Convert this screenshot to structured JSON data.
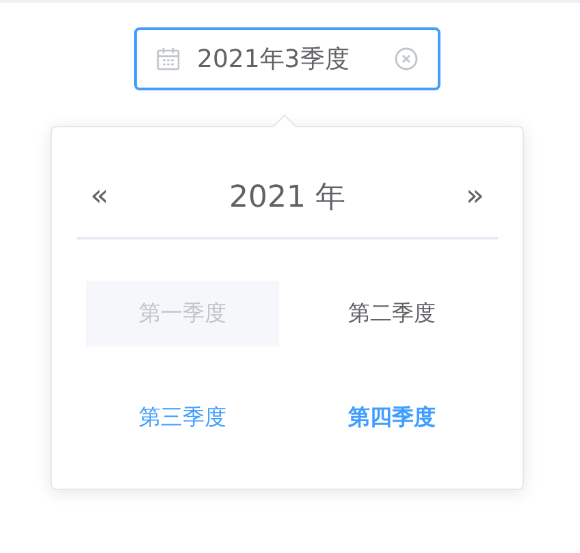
{
  "input": {
    "value": "2021年3季度"
  },
  "panel": {
    "prev": "«",
    "year": "2021 年",
    "next": "»"
  },
  "quarters": [
    {
      "label": "第一季度",
      "disabled": true,
      "selected": false,
      "current": false
    },
    {
      "label": "第二季度",
      "disabled": false,
      "selected": false,
      "current": false
    },
    {
      "label": "第三季度",
      "disabled": false,
      "selected": true,
      "current": false
    },
    {
      "label": "第四季度",
      "disabled": false,
      "selected": false,
      "current": true
    }
  ]
}
